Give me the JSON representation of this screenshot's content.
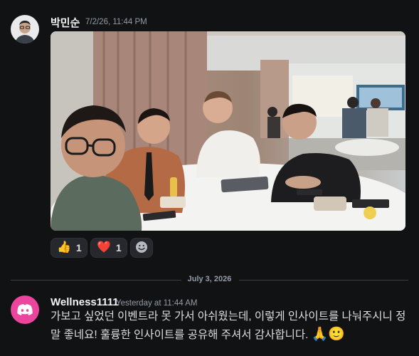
{
  "message1": {
    "author": "박민순",
    "timestamp": "7/2/26, 11:44 PM",
    "reactions": [
      {
        "emoji": "👍",
        "icon": "thumbs-up-icon",
        "count": "1"
      },
      {
        "emoji": "❤️",
        "icon": "heart-icon",
        "count": "1"
      }
    ],
    "add_reaction_icon": "smile-add-reaction-icon"
  },
  "divider": {
    "date": "July 3, 2026"
  },
  "message2": {
    "author": "Wellness1111",
    "timestamp": "Yesterday at 11:44 AM",
    "text": "가보고 싶었던 이벤트라 못 가서 아쉬웠는데, 이렇게 인사이트를 나눠주시니 정말 좋네요! 훌륭한 인사이트를 공유해 주셔서 감사합니다.",
    "emojis": "🙏🙂",
    "avatar_icon": "discord-logo-icon",
    "avatar_color": "#eb459e"
  },
  "colors": {
    "background": "#111214",
    "text": "#dbdee1",
    "muted": "#949ba4",
    "reaction_bg": "#26282d"
  }
}
